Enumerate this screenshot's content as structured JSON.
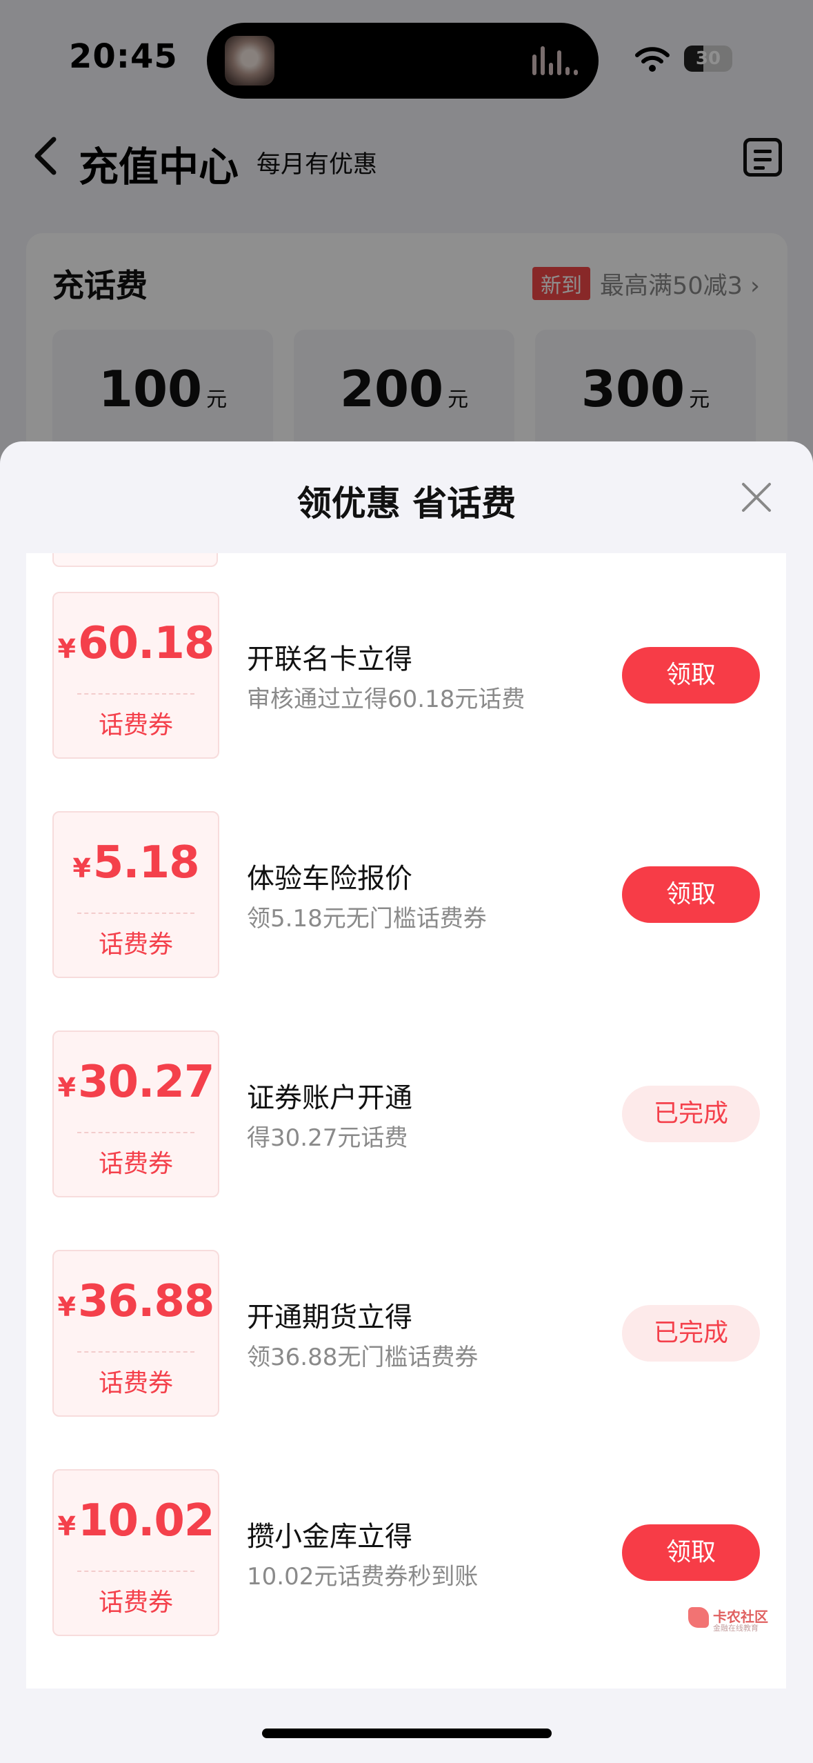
{
  "status_bar": {
    "time": "20:45",
    "battery": "30"
  },
  "header": {
    "title": "充值中心",
    "subtitle": "每月有优惠"
  },
  "recharge": {
    "title": "充话费",
    "promo_badge": "新到",
    "promo_text": "最高满50减3",
    "amounts": [
      {
        "value": "100",
        "unit": "元"
      },
      {
        "value": "200",
        "unit": "元"
      },
      {
        "value": "300",
        "unit": "元"
      }
    ]
  },
  "sheet": {
    "title": "领优惠 省话费",
    "offers": [
      {
        "yen": "¥",
        "amount": "60.18",
        "coupon_label": "话费券",
        "title": "开联名卡立得",
        "desc": "审核通过立得60.18元话费",
        "button": "领取",
        "status": "available"
      },
      {
        "yen": "¥",
        "amount": "5.18",
        "coupon_label": "话费券",
        "title": "体验车险报价",
        "desc": "领5.18元无门槛话费券",
        "button": "领取",
        "status": "available"
      },
      {
        "yen": "¥",
        "amount": "30.27",
        "coupon_label": "话费券",
        "title": "证券账户开通",
        "desc": "得30.27元话费",
        "button": "已完成",
        "status": "done"
      },
      {
        "yen": "¥",
        "amount": "36.88",
        "coupon_label": "话费券",
        "title": "开通期货立得",
        "desc": "领36.88无门槛话费券",
        "button": "已完成",
        "status": "done"
      },
      {
        "yen": "¥",
        "amount": "10.02",
        "coupon_label": "话费券",
        "title": "攒小金库立得",
        "desc": "10.02元话费券秒到账",
        "button": "领取",
        "status": "available"
      }
    ]
  },
  "watermark": {
    "name": "卡农社区",
    "sub": "金融在线教育"
  },
  "colors": {
    "accent": "#f73c47",
    "done_bg": "#fdeaea",
    "coupon_bg": "#fff3f3"
  }
}
